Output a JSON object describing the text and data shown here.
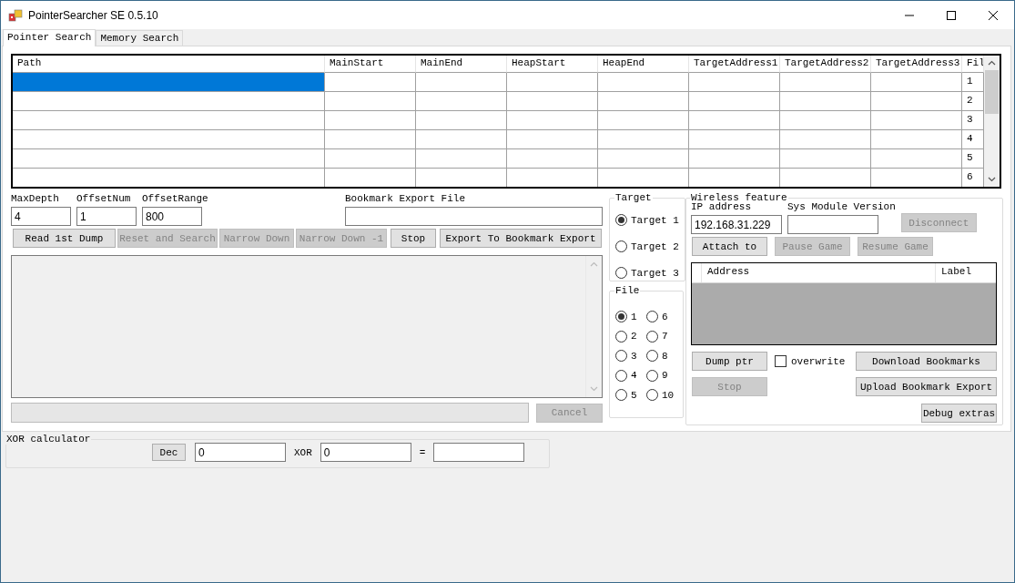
{
  "window": {
    "title": "PointerSearcher SE 0.5.10"
  },
  "tabs": [
    {
      "label": "Pointer Search",
      "selected": true
    },
    {
      "label": "Memory Search",
      "selected": false
    }
  ],
  "results_table": {
    "columns": [
      "Path",
      "MainStart",
      "MainEnd",
      "HeapStart",
      "HeapEnd",
      "TargetAddress1",
      "TargetAddress2",
      "TargetAddress3",
      "Fil"
    ],
    "rows": [
      {
        "selected": true,
        "file": "1"
      },
      {
        "selected": false,
        "file": "2"
      },
      {
        "selected": false,
        "file": "3"
      },
      {
        "selected": false,
        "file": "4"
      },
      {
        "selected": false,
        "file": "5"
      },
      {
        "selected": false,
        "file": "6"
      }
    ]
  },
  "search_fields": [
    {
      "label": "MaxDepth",
      "value": "4"
    },
    {
      "label": "OffsetNum",
      "value": "1"
    },
    {
      "label": "OffsetRange",
      "value": "800"
    }
  ],
  "bookmark_export_file": {
    "label": "Bookmark Export File"
  },
  "search_buttons": [
    {
      "label": "Read 1st Dump",
      "disabled": false
    },
    {
      "label": "Reset and Search",
      "disabled": true
    },
    {
      "label": "Narrow Down",
      "disabled": true
    },
    {
      "label": "Narrow Down -1",
      "disabled": true
    },
    {
      "label": "Stop",
      "disabled": false
    },
    {
      "label": "Export To Bookmark Export",
      "disabled": false
    }
  ],
  "progress": {
    "level": 0
  },
  "cancel_button": {
    "label": "Cancel",
    "disabled": true
  },
  "target_group": {
    "title": "Target",
    "options": [
      {
        "label": "Target 1",
        "selected": true
      },
      {
        "label": "Target 2",
        "selected": false
      },
      {
        "label": "Target 3",
        "selected": false
      }
    ]
  },
  "file_group": {
    "title": "File",
    "options": [
      {
        "label": "1",
        "selected": true
      },
      {
        "label": "2",
        "selected": false
      },
      {
        "label": "3",
        "selected": false
      },
      {
        "label": "4",
        "selected": false
      },
      {
        "label": "5",
        "selected": false
      },
      {
        "label": "6",
        "selected": false
      },
      {
        "label": "7",
        "selected": false
      },
      {
        "label": "8",
        "selected": false
      },
      {
        "label": "9",
        "selected": false
      },
      {
        "label": "10",
        "selected": false
      }
    ]
  },
  "wireless": {
    "title": "Wireless feature",
    "ip_label": "IP address",
    "ip_value": "192.168.31.229",
    "sys_module_label": "Sys Module Version",
    "disconnect_button": {
      "label": "Disconnect",
      "disabled": true
    },
    "attach_button": {
      "label": "Attach to",
      "disabled": false
    },
    "pause_button": {
      "label": "Pause Game",
      "disabled": true
    },
    "resume_button": {
      "label": "Resume Game",
      "disabled": true
    },
    "bookmark_table": {
      "columns": [
        "Address",
        "Label"
      ]
    },
    "dump_button": {
      "label": "Dump ptr",
      "disabled": false
    },
    "overwrite": {
      "label": "overwrite",
      "checked": false
    },
    "download_button": {
      "label": "Download Bookmarks",
      "disabled": false
    },
    "stop_button": {
      "label": "Stop",
      "disabled": true
    },
    "upload_button": {
      "label": "Upload Bookmark Export",
      "disabled": false
    },
    "debug_button": {
      "label": "Debug extras",
      "disabled": false
    }
  },
  "xor": {
    "title": "XOR calculator",
    "mode_button": "Dec",
    "left_value": "0",
    "operator": "XOR",
    "right_value": "0",
    "equals": "="
  }
}
